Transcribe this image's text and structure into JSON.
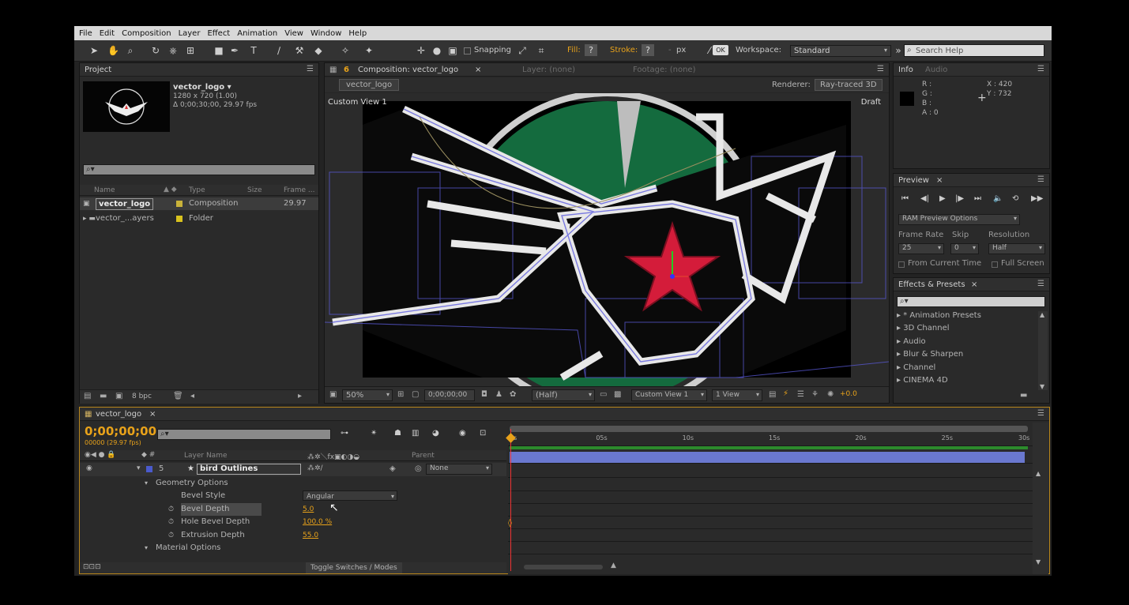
{
  "menu": [
    "File",
    "Edit",
    "Composition",
    "Layer",
    "Effect",
    "Animation",
    "View",
    "Window",
    "Help"
  ],
  "toolbar": {
    "snapping": "Snapping",
    "fill": "Fill:",
    "stroke": "Stroke:",
    "px": "px",
    "workspace_label": "Workspace:",
    "workspace_value": "Standard",
    "search_placeholder": "Search Help"
  },
  "project": {
    "tab": "Project",
    "item_name": "vector_logo ▾",
    "item_res": "1280 x 720 (1.00)",
    "item_dur": "Δ 0;00;30;00, 29.97 fps",
    "columns": [
      "Name",
      "Type",
      "Size",
      "Frame ..."
    ],
    "rows": [
      {
        "name": "vector_logo",
        "type": "Composition",
        "size": "",
        "frame": "29.97",
        "color": "#c9b23a"
      },
      {
        "name": "vector_...ayers",
        "type": "Folder",
        "size": "",
        "frame": "",
        "color": "#d8c21e"
      }
    ],
    "bpc": "8 bpc"
  },
  "comp": {
    "tab_num": "6",
    "tab": "Composition: vector_logo",
    "layer_tab": "Layer: (none)",
    "footage_tab": "Footage: (none)",
    "sub_tab": "vector_logo",
    "renderer_label": "Renderer:",
    "renderer_value": "Ray-traced 3D",
    "view_name": "Custom View 1",
    "draft": "Draft",
    "zoom": "50%",
    "timecode": "0;00;00;00",
    "resolution": "(Half)",
    "view_select": "Custom View 1",
    "views": "1 View",
    "exposure": "+0.0"
  },
  "info": {
    "tab": "Info",
    "tab2": "Audio",
    "r": "R :",
    "g": "G :",
    "b": "B :",
    "a": "A : 0",
    "x": "X : 420",
    "y": "Y : 732"
  },
  "preview": {
    "tab": "Preview",
    "ram": "RAM Preview Options",
    "frame_rate_label": "Frame Rate",
    "skip_label": "Skip",
    "resolution_label": "Resolution",
    "frame_rate": "25",
    "skip": "0",
    "resolution": "Half",
    "from_current": "From Current Time",
    "full_screen": "Full Screen"
  },
  "effects": {
    "tab": "Effects & Presets",
    "items": [
      "* Animation Presets",
      "3D Channel",
      "Audio",
      "Blur & Sharpen",
      "Channel",
      "CINEMA 4D"
    ]
  },
  "timeline": {
    "tab": "vector_logo",
    "timecode": "0;00;00;00",
    "subcode": "00000 (29.97 fps)",
    "col_layer": "Layer Name",
    "col_parent": "Parent",
    "layer_num": "5",
    "layer_name": "bird Outlines",
    "parent": "None",
    "props": [
      {
        "name": "Geometry Options",
        "value": "",
        "indent": 1
      },
      {
        "name": "Bevel Style",
        "value": "Angular",
        "indent": 2
      },
      {
        "name": "Bevel Depth",
        "value": "5.0",
        "indent": 2
      },
      {
        "name": "Hole Bevel Depth",
        "value": "100.0 %",
        "indent": 2
      },
      {
        "name": "Extrusion Depth",
        "value": "55.0",
        "indent": 2
      },
      {
        "name": "Material Options",
        "value": "",
        "indent": 1
      }
    ],
    "toggle": "Toggle Switches / Modes",
    "ruler": [
      "0s",
      "05s",
      "10s",
      "15s",
      "20s",
      "25s",
      "30s"
    ]
  }
}
